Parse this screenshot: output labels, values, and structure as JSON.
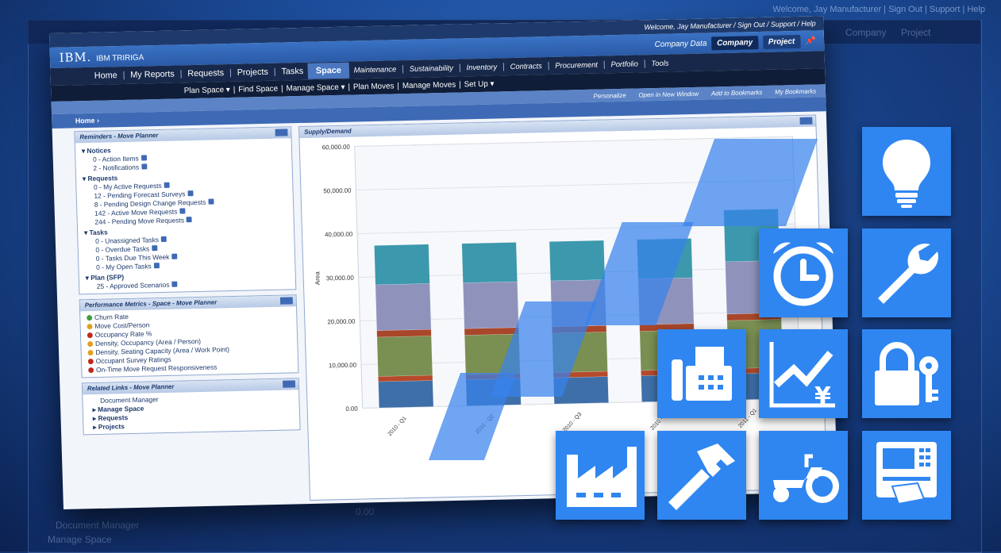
{
  "ghost": {
    "top_links": "Welcome, Jay Manufacturer  |  Sign Out  |  Support  |  Help",
    "company": "Company",
    "project": "Project",
    "panel_item": "Document Manager",
    "panel_item2": "Manage Space",
    "ylabel": "0.00"
  },
  "header": {
    "welcome": "Welcome, Jay Manufacturer  /  Sign Out  /  Support  /  Help",
    "logo": "IBM.",
    "product": "IBM TRIRIGA",
    "company_data": "Company Data",
    "company_pill": "Company",
    "project_pill": "Project"
  },
  "nav": {
    "items": [
      "Home",
      "My Reports",
      "Requests",
      "Projects",
      "Tasks"
    ],
    "active": "Space",
    "right_items": [
      "Maintenance",
      "Sustainability",
      "Inventory",
      "Contracts",
      "Procurement",
      "Portfolio",
      "Tools"
    ]
  },
  "subnav": {
    "items": [
      "Plan Space ▾",
      "Find Space",
      "Manage Space ▾",
      "Plan Moves",
      "Manage Moves",
      "Set Up ▾"
    ]
  },
  "toolbar": {
    "personalize": "Personalize",
    "open_window": "Open in New Window",
    "add_bookmarks": "Add to Bookmarks",
    "my_bookmarks": "My Bookmarks"
  },
  "breadcrumb": "Home  ›",
  "reminders": {
    "title": "Reminders - Move Planner",
    "groups": [
      {
        "name": "Notices",
        "items": [
          "0 - Action Items",
          "2 - Notifications"
        ]
      },
      {
        "name": "Requests",
        "items": [
          "0 - My Active Requests",
          "12 - Pending Forecast Surveys",
          "8 - Pending Design Change Requests",
          "142 - Active Move Requests",
          "244 - Pending Move Requests"
        ]
      },
      {
        "name": "Tasks",
        "items": [
          "0 - Unassigned Tasks",
          "0 - Overdue Tasks",
          "0 - Tasks Due This Week",
          "0 - My Open Tasks"
        ]
      },
      {
        "name": "Plan (SFP)",
        "items": [
          "25 - Approved Scenarios"
        ]
      }
    ]
  },
  "metrics": {
    "title": "Performance Metrics - Space - Move Planner",
    "items": [
      {
        "label": "Churn Rate",
        "status": "#3ca03c"
      },
      {
        "label": "Move Cost/Person",
        "status": "#e0a020"
      },
      {
        "label": "Occupancy Rate %",
        "status": "#c0281c"
      },
      {
        "label": "Density, Occupancy (Area / Person)",
        "status": "#e0a020"
      },
      {
        "label": "Density, Seating Capacity (Area / Work Point)",
        "status": "#e0a020"
      },
      {
        "label": "Occupant Survey Ratings",
        "status": "#c0281c"
      },
      {
        "label": "On-Time Move Request Responsiveness",
        "status": "#c0281c"
      }
    ]
  },
  "links": {
    "title": "Related Links - Move Planner",
    "items": [
      "Document Manager",
      "Manage Space",
      "Requests",
      "Projects"
    ]
  },
  "chart_panel_title": "Supply/Demand",
  "chart_data": {
    "type": "bar",
    "title": "Supply/Demand",
    "ylabel": "Area",
    "ylim": [
      0,
      60000
    ],
    "yticks": [
      "0.00",
      "10,000.00",
      "20,000.00",
      "30,000.00",
      "40,000.00",
      "50,000.00",
      "60,000.00"
    ],
    "categories": [
      "2010 - Q1",
      "2010 - Q2",
      "2010 - Q3",
      "2010 - Q4",
      "2011 - Q1"
    ],
    "category_labels_visible": [
      "2010 - Q1",
      "2010 - Q2",
      "2010 - Q3",
      "2010 - Q4",
      "2011 - Q1"
    ],
    "series": [
      {
        "color": "#3e6fa8",
        "values": [
          6000,
          6000,
          6000,
          6000,
          6000
        ]
      },
      {
        "color": "#b54a2a",
        "values": [
          1200,
          1200,
          1200,
          1200,
          1200
        ]
      },
      {
        "color": "#7a8f52",
        "values": [
          9000,
          9000,
          9000,
          9000,
          11000
        ]
      },
      {
        "color": "#a8472a",
        "values": [
          1500,
          1500,
          1500,
          1500,
          1500
        ]
      },
      {
        "color": "#8f93bc",
        "values": [
          10500,
          10500,
          10500,
          10500,
          12000
        ]
      },
      {
        "color": "#3c98ad",
        "values": [
          9000,
          9000,
          9000,
          9000,
          11800
        ]
      }
    ]
  },
  "tiles": [
    {
      "icon": "lightbulb-icon"
    },
    {
      "icon": "alarm-clock-icon"
    },
    {
      "icon": "wrench-icon"
    },
    {
      "icon": "fax-icon"
    },
    {
      "icon": "chart-yen-icon"
    },
    {
      "icon": "lock-key-icon"
    },
    {
      "icon": "factory-icon"
    },
    {
      "icon": "hammer-icon"
    },
    {
      "icon": "tractor-icon"
    },
    {
      "icon": "atm-icon"
    }
  ],
  "colors": {
    "tile": "#2f86f0",
    "nav": "#17284a",
    "brand": "#2a5aa6"
  }
}
